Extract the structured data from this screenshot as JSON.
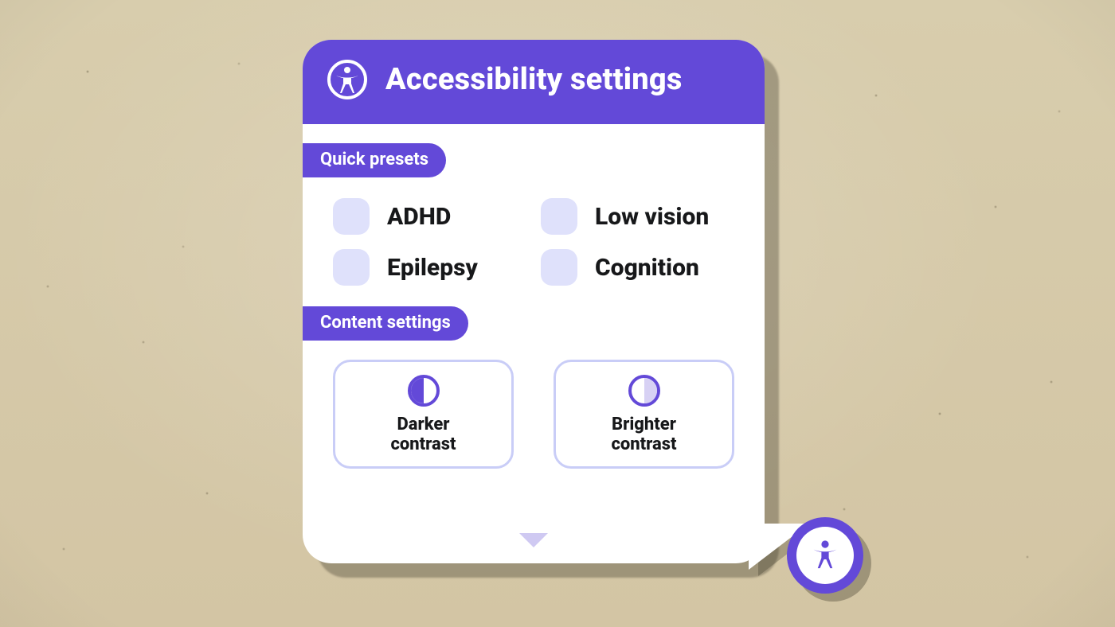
{
  "colors": {
    "accent": "#6349d8",
    "checkbox": "#dfe1fb",
    "card_border": "#c9cdf7"
  },
  "panel": {
    "title": "Accessibility settings",
    "sections": {
      "presets": {
        "heading": "Quick presets",
        "items": [
          {
            "label": "ADHD",
            "checked": false
          },
          {
            "label": "Low vision",
            "checked": false
          },
          {
            "label": "Epilepsy",
            "checked": false
          },
          {
            "label": "Cognition",
            "checked": false
          }
        ]
      },
      "content": {
        "heading": "Content settings",
        "cards": [
          {
            "label": "Darker\ncontrast",
            "icon": "contrast-dark"
          },
          {
            "label": "Brighter\ncontrast",
            "icon": "contrast-light"
          }
        ]
      }
    }
  },
  "fab": {
    "name": "accessibility-launcher"
  }
}
